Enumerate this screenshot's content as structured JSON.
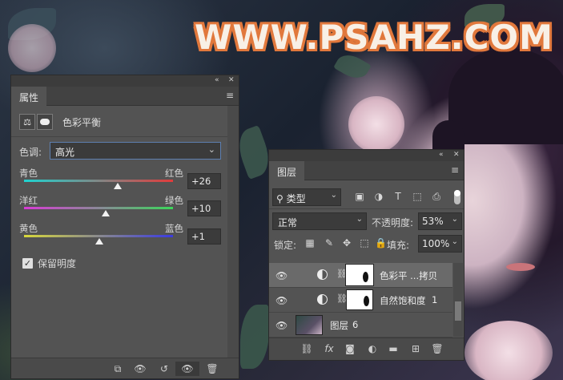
{
  "watermark": "WWW.PSAHZ.COM",
  "properties_panel": {
    "tab": "属性",
    "title": "色彩平衡",
    "tone_label": "色调:",
    "tone_value": "高光",
    "sliders": [
      {
        "left": "青色",
        "right": "红色",
        "value": "+26",
        "gradient": [
          "#1fd3d0",
          "#e23b3b"
        ],
        "fraction": 0.63
      },
      {
        "left": "洋红",
        "right": "绿色",
        "value": "+10",
        "gradient": [
          "#d93bd6",
          "#3bd65a"
        ],
        "fraction": 0.55
      },
      {
        "left": "黄色",
        "right": "蓝色",
        "value": "+1",
        "gradient": [
          "#d8d83b",
          "#3b3be0"
        ],
        "fraction": 0.505
      }
    ],
    "preserve_luminosity_label": "保留明度",
    "preserve_luminosity_checked": true,
    "icons": {
      "collapse": "«",
      "close": "✕",
      "menu": "≡",
      "checkmark": "✓",
      "balance": "⚖",
      "clip": "⧉",
      "view_prev": "👁",
      "reset": "↺",
      "visibility": "👁",
      "trash": "🗑"
    }
  },
  "layers_panel": {
    "tab": "图层",
    "kind_filter": "类型",
    "blend_mode": "正常",
    "opacity_label": "不透明度:",
    "opacity_value": "53%",
    "lock_label": "锁定:",
    "fill_label": "填充:",
    "fill_value": "100%",
    "icons": {
      "search": "⚲",
      "chevron": "⌄",
      "filter_pixel": "▣",
      "filter_adjust": "◑",
      "filter_type": "T",
      "filter_shape": "⬚",
      "filter_smart": "⎙",
      "lock_transparent": "▦",
      "lock_paint": "✎",
      "lock_move": "✥",
      "lock_artboard": "⬚",
      "lock_all": "🔒",
      "link": "⛓",
      "fx": "fx",
      "mask": "◙",
      "adjust": "◐",
      "folder": "▬",
      "new": "⊞",
      "delete": "🗑",
      "eye": "👁",
      "chain": "⛓"
    },
    "layers": [
      {
        "name": "色彩平 ...拷贝",
        "type": "adjustment",
        "selected": true
      },
      {
        "name": "自然饱和度",
        "suffix": "1",
        "type": "adjustment",
        "selected": false
      },
      {
        "name": "图层",
        "suffix": "6",
        "type": "pixel",
        "selected": false
      }
    ]
  }
}
